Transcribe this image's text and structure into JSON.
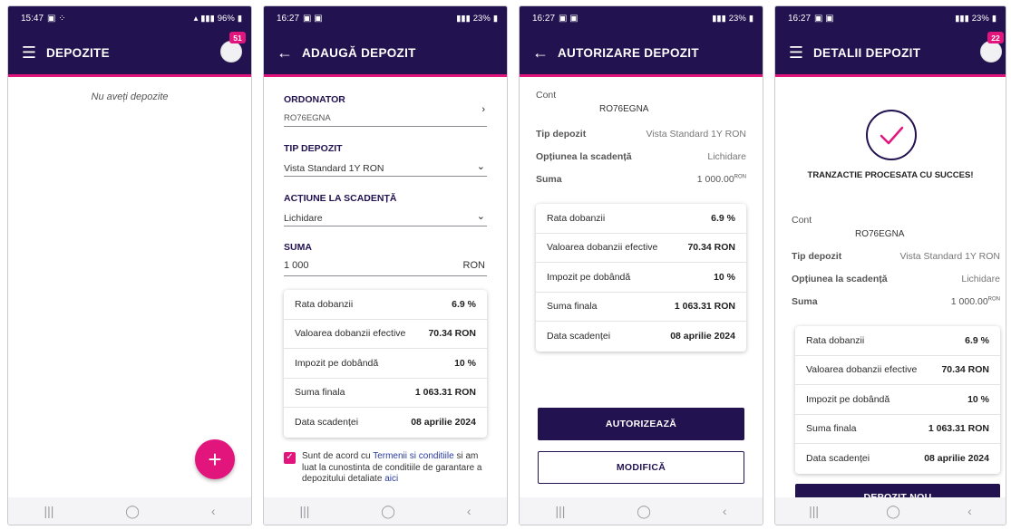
{
  "colors": {
    "primary": "#22124f",
    "accent": "#e2157d"
  },
  "screen1": {
    "status": {
      "time": "15:47",
      "battery": "96%"
    },
    "title": "DEPOZITE",
    "badge": "51",
    "empty_text": "Nu aveți depozite",
    "fab_label": "+",
    "icons": {
      "menu": "menu-icon",
      "add": "plus-icon"
    }
  },
  "screen2": {
    "status": {
      "time": "16:27",
      "battery": "23%"
    },
    "title": "ADAUGĂ DEPOZIT",
    "ordonator": {
      "label": "ORDONATOR",
      "value": "RO76EGNA"
    },
    "tip": {
      "label": "TIP DEPOZIT",
      "value": "Vista Standard 1Y RON"
    },
    "actiune": {
      "label": "ACȚIUNE LA SCADENȚĂ",
      "value": "Lichidare"
    },
    "suma": {
      "label": "SUMA",
      "value": "1 000",
      "currency": "RON"
    },
    "summary": [
      {
        "label": "Rata dobanzii",
        "value": "6.9 %"
      },
      {
        "label": "Valoarea dobanzii efective",
        "value": "70.34 RON"
      },
      {
        "label": "Impozit pe dobândă",
        "value": "10 %"
      },
      {
        "label": "Suma finala",
        "value": "1 063.31 RON"
      },
      {
        "label": "Data scadenței",
        "value": "08 aprilie 2024"
      }
    ],
    "terms": {
      "t1": "Sunt de acord cu ",
      "link1": "Termenii si conditiile",
      "t2": " si am luat la cunostinta de conditiile de garantare a depozitului detaliate ",
      "link2": "aici"
    }
  },
  "screen3": {
    "status": {
      "time": "16:27",
      "battery": "23%"
    },
    "title": "AUTORIZARE DEPOZIT",
    "cont_label": "Cont",
    "cont_value": "RO76EGNA",
    "details": [
      {
        "label": "Tip depozit",
        "value": "Vista Standard 1Y RON"
      },
      {
        "label": "Opțiunea la scadență",
        "value": "Lichidare"
      },
      {
        "label": "Suma",
        "value": "1 000.00",
        "sup": "RON"
      }
    ],
    "summary": [
      {
        "label": "Rata dobanzii",
        "value": "6.9 %"
      },
      {
        "label": "Valoarea dobanzii efective",
        "value": "70.34 RON"
      },
      {
        "label": "Impozit pe dobândă",
        "value": "10 %"
      },
      {
        "label": "Suma finala",
        "value": "1 063.31 RON"
      },
      {
        "label": "Data scadenței",
        "value": "08 aprilie 2024"
      }
    ],
    "btn_authorize": "AUTORIZEAZĂ",
    "btn_modify": "MODIFICĂ"
  },
  "screen4": {
    "status": {
      "time": "16:27",
      "battery": "23%"
    },
    "title": "DETALII DEPOZIT",
    "badge": "22",
    "success_text": "TRANZACTIE PROCESATA CU SUCCES!",
    "cont_label": "Cont",
    "cont_value": "RO76EGNA",
    "details": [
      {
        "label": "Tip depozit",
        "value": "Vista Standard 1Y RON"
      },
      {
        "label": "Opțiunea la scadență",
        "value": "Lichidare"
      },
      {
        "label": "Suma",
        "value": "1 000.00",
        "sup": "RON"
      }
    ],
    "summary": [
      {
        "label": "Rata dobanzii",
        "value": "6.9 %"
      },
      {
        "label": "Valoarea dobanzii efective",
        "value": "70.34 RON"
      },
      {
        "label": "Impozit pe dobândă",
        "value": "10 %"
      },
      {
        "label": "Suma finala",
        "value": "1 063.31 RON"
      },
      {
        "label": "Data scadenței",
        "value": "08 aprilie 2024"
      }
    ],
    "btn_new": "DEPOZIT NOU"
  }
}
